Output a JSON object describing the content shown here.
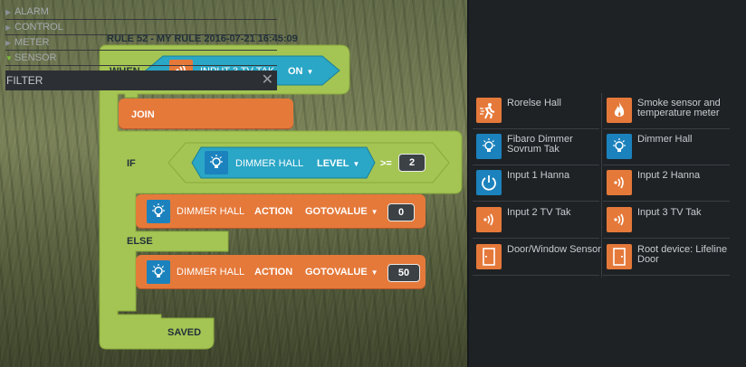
{
  "rule": {
    "title": "RULE 52 - MY RULE 2016-07-21 16:45:09",
    "when_label": "WHEN",
    "trigger": {
      "device": "INPUT 3 TV TAK",
      "state": "ON"
    },
    "join_label": "JOIN",
    "if_label": "IF",
    "condition": {
      "device": "DIMMER HALL",
      "property": "LEVEL",
      "operator": ">=",
      "value": "2"
    },
    "then_action": {
      "device": "DIMMER HALL",
      "action_label": "ACTION",
      "action": "GOTOVALUE",
      "value": "0"
    },
    "else_label": "ELSE",
    "else_action": {
      "device": "DIMMER HALL",
      "action_label": "ACTION",
      "action": "GOTOVALUE",
      "value": "50"
    },
    "saved_label": "SAVED"
  },
  "colors": {
    "green": "#a4c553",
    "teal": "#2aa6c6",
    "orange": "#e5793a",
    "icon_blue": "#1b82bd",
    "panel_bg": "#1f2225"
  },
  "panel": {
    "categories": [
      {
        "label": "ALARM",
        "expanded": false
      },
      {
        "label": "CONTROL",
        "expanded": false
      },
      {
        "label": "METER",
        "expanded": false
      },
      {
        "label": "SENSOR",
        "expanded": true
      }
    ],
    "filter_label": "FILTER",
    "devices": [
      {
        "name": "Rorelse Hall",
        "icon": "motion-sensor-icon",
        "color": "#e5793a"
      },
      {
        "name": "Smoke sensor and temperature meter",
        "icon": "flame-icon",
        "color": "#e5793a"
      },
      {
        "name": "Fibaro Dimmer Sovrum Tak",
        "icon": "bulb-icon",
        "color": "#1b82bd"
      },
      {
        "name": "Dimmer Hall",
        "icon": "bulb-icon",
        "color": "#1b82bd"
      },
      {
        "name": "Input 1 Hanna",
        "icon": "power-icon",
        "color": "#1b82bd"
      },
      {
        "name": "Input 2 Hanna",
        "icon": "signal-icon",
        "color": "#e5793a"
      },
      {
        "name": "Input 2 TV Tak",
        "icon": "signal-icon",
        "color": "#e5793a"
      },
      {
        "name": "Input 3 TV Tak",
        "icon": "signal-icon",
        "color": "#e5793a"
      },
      {
        "name": "Door/Window Sensor",
        "icon": "door-icon",
        "color": "#e5793a"
      },
      {
        "name": "Root device: Lifeline Door",
        "icon": "door-icon",
        "color": "#e5793a"
      }
    ]
  }
}
